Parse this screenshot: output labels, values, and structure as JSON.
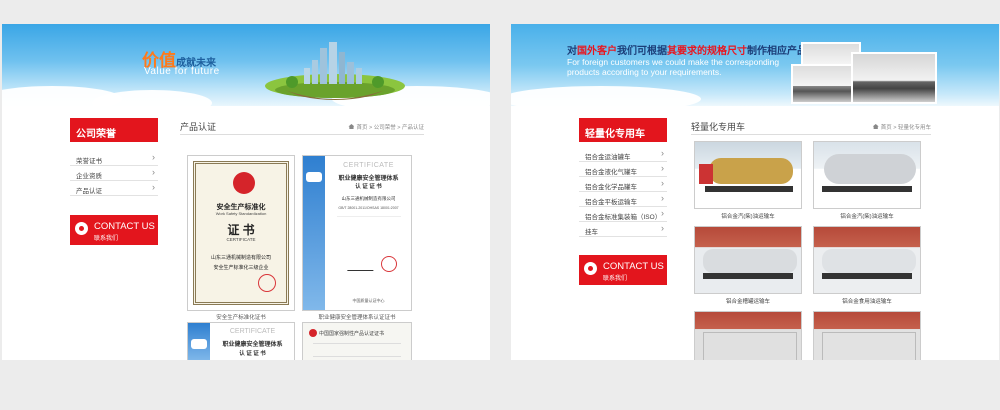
{
  "left_page": {
    "banner": {
      "slogan_cn_main": "价值",
      "slogan_cn_sub": "成就未来",
      "slogan_en": "Value for future"
    },
    "sidebar": {
      "heading": "公司荣誉",
      "items": [
        {
          "label": "荣誉证书"
        },
        {
          "label": "企业资质"
        },
        {
          "label": "产品认证"
        }
      ],
      "contact_en": "CONTACT US",
      "contact_cn": "联系我们"
    },
    "content": {
      "title": "产品认证",
      "breadcrumb": "首页 > 公司荣誉 > 产品认证",
      "certificates": [
        {
          "caption": "安全生产标准化证书",
          "top_line": "安全生产标准化",
          "en_line": "Work Safety Standardization",
          "big": "证 书",
          "sub": "CERTIFICATE",
          "company": "山东三通机械制造有限公司",
          "desc": "安全生产标准化三级企业"
        },
        {
          "caption": "职业健康安全管理体系认证证书",
          "head": "CERTIFICATE",
          "title": "职业健康安全管理体系",
          "title2": "认 证 证 书",
          "company": "山东三通机械制造有限公司",
          "std": "GB/T 28001-2011/OHSAS 18001:2007",
          "footer": "中国质量认证中心"
        },
        {
          "caption": "",
          "head": "CERTIFICATE",
          "title": "职业健康安全管理体系",
          "title2": "认 证 证 书"
        },
        {
          "caption": "",
          "head": "中国国家强制性产品认证证书"
        }
      ]
    }
  },
  "right_page": {
    "banner": {
      "cn_pre": "对",
      "cn_hl1": "国外客户",
      "cn_mid": "我们可根据",
      "cn_hl2": "其要求的规格尺寸",
      "cn_post": "制作相应产品",
      "en": "For foreign customers we could make the corresponding products according to your requirements."
    },
    "sidebar": {
      "heading": "轻量化专用车",
      "items": [
        {
          "label": "铝合金运油罐车"
        },
        {
          "label": "铝合金液化气罐车"
        },
        {
          "label": "铝合金化学品罐车"
        },
        {
          "label": "铝合金平板运输车"
        },
        {
          "label": "铝合金标准集装箱（ISO）"
        },
        {
          "label": "挂车"
        }
      ],
      "contact_en": "CONTACT US",
      "contact_cn": "联系我们"
    },
    "content": {
      "title": "轻量化专用车",
      "breadcrumb": "首页 > 轻量化专用车",
      "products": [
        {
          "caption": "铝合金汽(柴)油运输车",
          "color": "#c9a24a"
        },
        {
          "caption": "铝合金汽(柴)油运输车",
          "color": "#cfd2d6"
        },
        {
          "caption": "铝合金槽罐运输车",
          "color": "#d9dcdf"
        },
        {
          "caption": "铝合金食用油运输车",
          "color": "#dfe2e5"
        },
        {
          "caption": "",
          "color": "#e0e0e0"
        },
        {
          "caption": "",
          "color": "#e2e2e2"
        }
      ]
    }
  },
  "colors": {
    "brand_red": "#e3151d",
    "sky_blue": "#3aa6e6",
    "accent_orange": "#ff7a1a"
  }
}
